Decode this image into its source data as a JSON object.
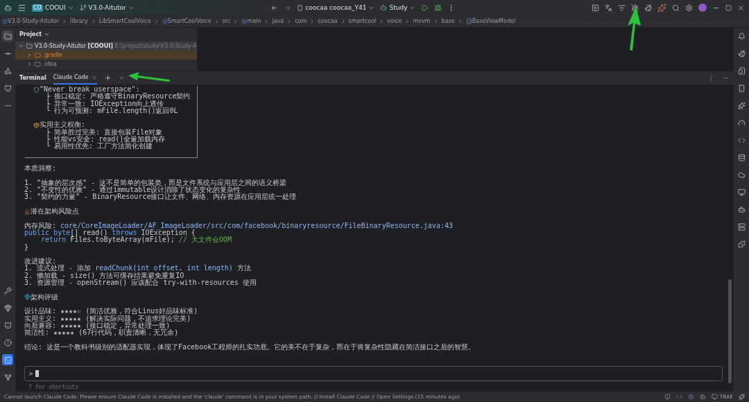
{
  "titlebar": {
    "project": {
      "badge": "CO",
      "name": "COOUI"
    },
    "branch": "V3.0-Aitutor",
    "device": "coocaa coocaa_Y41",
    "run_config": "Study"
  },
  "breadcrumbs": [
    {
      "label": "V3.0-Study-Aitutor",
      "kind": "module"
    },
    {
      "label": "library",
      "kind": "folder"
    },
    {
      "label": "LibSmartCoolVoice",
      "kind": "folder"
    },
    {
      "label": "SmartCoolVoice",
      "kind": "module"
    },
    {
      "label": "src",
      "kind": "folder"
    },
    {
      "label": "main",
      "kind": "module"
    },
    {
      "label": "java",
      "kind": "folder"
    },
    {
      "label": "com",
      "kind": "folder"
    },
    {
      "label": "coocaa",
      "kind": "folder"
    },
    {
      "label": "smartcool",
      "kind": "folder"
    },
    {
      "label": "voice",
      "kind": "folder"
    },
    {
      "label": "mvvm",
      "kind": "folder"
    },
    {
      "label": "base",
      "kind": "folder"
    },
    {
      "label": "BaseViewModel",
      "kind": "class"
    }
  ],
  "project_panel": {
    "title": "Project",
    "tree": [
      {
        "label": "V3.0-Study-Aitutor",
        "tag": "[COOUI]",
        "path": "E:\\project\\study\\V3.0-Study-A",
        "expanded": true,
        "selected": false,
        "children": [
          {
            "label": ".gradle",
            "expanded": false,
            "selected": true
          },
          {
            "label": ".idea",
            "expanded": false,
            "selected": false
          }
        ]
      }
    ]
  },
  "terminal": {
    "title": "Terminal",
    "tabs": [
      {
        "label": "Claude Code",
        "selected": true
      }
    ],
    "lines": [
      {
        "kind": "box",
        "lines": [
          {
            "kind": "shield",
            "segments": [
              {
                "text": "\"Never break userspace\":"
              }
            ]
          },
          {
            "kind": "text",
            "segments": [
              {
                "text": "   ├ 接口稳定: 严格遵守BinaryResource契约"
              }
            ]
          },
          {
            "kind": "text",
            "segments": [
              {
                "text": "   ├ 异常一致: IOException向上透传"
              }
            ]
          },
          {
            "kind": "text",
            "segments": [
              {
                "text": "   └ 行为可预测: mFile.length()返回0L"
              }
            ]
          },
          {
            "kind": "blank"
          },
          {
            "kind": "scale",
            "segments": [
              {
                "text": "实用主义权衡:"
              }
            ]
          },
          {
            "kind": "text",
            "segments": [
              {
                "text": "   ├ 简单胜过完美: 直接包装File对象"
              }
            ]
          },
          {
            "kind": "text",
            "segments": [
              {
                "text": "   ├ 性能vs安全: read()全量加载内存"
              }
            ]
          },
          {
            "kind": "text",
            "segments": [
              {
                "text": "   └ 易用性优先: 工厂方法简化创建"
              }
            ]
          },
          {
            "kind": "blank"
          }
        ]
      },
      {
        "kind": "blank"
      },
      {
        "kind": "text",
        "segments": [
          {
            "text": "本质洞察:"
          }
        ]
      },
      {
        "kind": "blank"
      },
      {
        "kind": "text",
        "segments": [
          {
            "text": "1. \"抽象的层次感\" - 这不是简单的包装类，而是文件系统与应用层之间的语义桥梁"
          }
        ]
      },
      {
        "kind": "text",
        "segments": [
          {
            "text": "2. \"不变性的优雅\" - 通过immutable设计消除了状态变化的复杂性"
          }
        ]
      },
      {
        "kind": "text",
        "segments": [
          {
            "text": "3. \"契约的力量\" - BinaryResource接口让文件、网络、内存资源在应用层统一处理"
          }
        ]
      },
      {
        "kind": "blank"
      },
      {
        "kind": "alert",
        "segments": [
          {
            "text": "潜在架构风险点"
          }
        ]
      },
      {
        "kind": "blank"
      },
      {
        "kind": "text",
        "segments": [
          {
            "text": "内存风险: "
          },
          {
            "text": "core/CoreImageLoader/AF_ImageLoader/src/com/facebook/binaryresource/FileBinaryResource.java:43",
            "kind": "path"
          }
        ]
      },
      {
        "kind": "text",
        "segments": [
          {
            "text": "public byte",
            "kind": "keyword"
          },
          {
            "text": "[] read() "
          },
          {
            "text": "throws",
            "kind": "keyword"
          },
          {
            "text": " IOException {"
          }
        ]
      },
      {
        "kind": "text",
        "segments": [
          {
            "text": "    return",
            "kind": "keyword"
          },
          {
            "text": " Files.toByteArray(mFile); "
          },
          {
            "text": "// 大文件会OOM",
            "kind": "comment"
          }
        ]
      },
      {
        "kind": "text",
        "segments": [
          {
            "text": "}"
          }
        ]
      },
      {
        "kind": "blank"
      },
      {
        "kind": "text",
        "segments": [
          {
            "text": "改进建议:"
          }
        ]
      },
      {
        "kind": "text",
        "segments": [
          {
            "text": "1. 流式处理 - 添加 "
          },
          {
            "text": "readChunk(int offset, int length)",
            "kind": "path"
          },
          {
            "text": " 方法"
          }
        ]
      },
      {
        "kind": "text",
        "segments": [
          {
            "text": "2. 懒加载 - size() 方法可缓存结果避免重复IO"
          }
        ]
      },
      {
        "kind": "text",
        "segments": [
          {
            "text": "3. 资源管理 - openStream() 应该配合 try-with-resources 使用"
          }
        ]
      },
      {
        "kind": "blank"
      },
      {
        "kind": "gem",
        "segments": [
          {
            "text": "架构评级"
          }
        ]
      },
      {
        "kind": "blank"
      },
      {
        "kind": "text",
        "segments": [
          {
            "text": "设计品味: ★★★★☆ (简洁优雅，符合Linus好品味标准)"
          }
        ]
      },
      {
        "kind": "text",
        "segments": [
          {
            "text": "实用主义: ★★★★★ (解决实际问题，不追求理论完美)"
          }
        ]
      },
      {
        "kind": "text",
        "segments": [
          {
            "text": "向后兼容: ★★★★★ (接口稳定，异常处理一致)"
          }
        ]
      },
      {
        "kind": "text",
        "segments": [
          {
            "text": "简洁性: ★★★★★ (67行代码，职责清晰，无冗余)"
          }
        ]
      },
      {
        "kind": "blank"
      },
      {
        "kind": "text",
        "segments": [
          {
            "text": "结论: 这是一个教科书级别的适配器实现，体现了Facebook工程师的扎实功底。它的美不在于复杂，而在于将复杂性隐藏在简洁接口之后的智慧。"
          }
        ]
      }
    ],
    "prompt": ">",
    "hint": "? for shortcuts"
  },
  "status_bar": {
    "message": "Cannot launch Claude Code: Please ensure Claude Code is installed and the 'claude' command is in your system path. // Install Claude Code // Open Settings (15 minutes ago)",
    "plugin": "TRAE"
  }
}
